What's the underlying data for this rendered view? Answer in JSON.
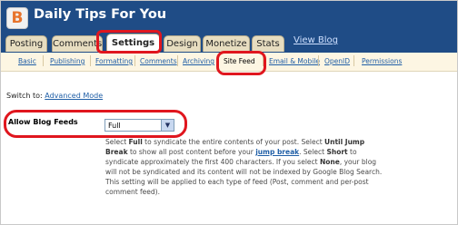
{
  "blog": {
    "title": "Daily Tips For You",
    "logo_letter": "B"
  },
  "tabs": [
    {
      "label": "Posting"
    },
    {
      "label": "Comments"
    },
    {
      "label": "Settings",
      "active": true
    },
    {
      "label": "Design"
    },
    {
      "label": "Monetize"
    },
    {
      "label": "Stats"
    }
  ],
  "view_blog": "View Blog",
  "subnav": [
    {
      "label": "Basic"
    },
    {
      "label": "Publishing"
    },
    {
      "label": "Formatting"
    },
    {
      "label": "Comments"
    },
    {
      "label": "Archiving"
    },
    {
      "label": "Site Feed",
      "active": true
    },
    {
      "label": "Email & Mobile"
    },
    {
      "label": "OpenID"
    },
    {
      "label": "Permissions"
    }
  ],
  "switch": {
    "prefix": "Switch to:",
    "link": "Advanced Mode"
  },
  "setting": {
    "label": "Allow Blog Feeds",
    "value": "Full",
    "description": {
      "p1": "Select ",
      "b1": "Full",
      "p2": " to syndicate the entire contents of your post. Select ",
      "b2": "Until Jump Break",
      "p3": " to show all post content before your ",
      "link": "jump break",
      "p4": ". Select ",
      "b3": "Short",
      "p5": " to syndicate approximately the first 400 characters. If you select ",
      "b4": "None",
      "p6": ", your blog will not be syndicated and its content will not be indexed by Google Blog Search. This setting will be applied to each type of feed (Post, comment and per-post comment feed)."
    }
  },
  "colors": {
    "header_bg": "#1f4c86",
    "highlight": "#e0161e",
    "link": "#1f5ea6"
  }
}
